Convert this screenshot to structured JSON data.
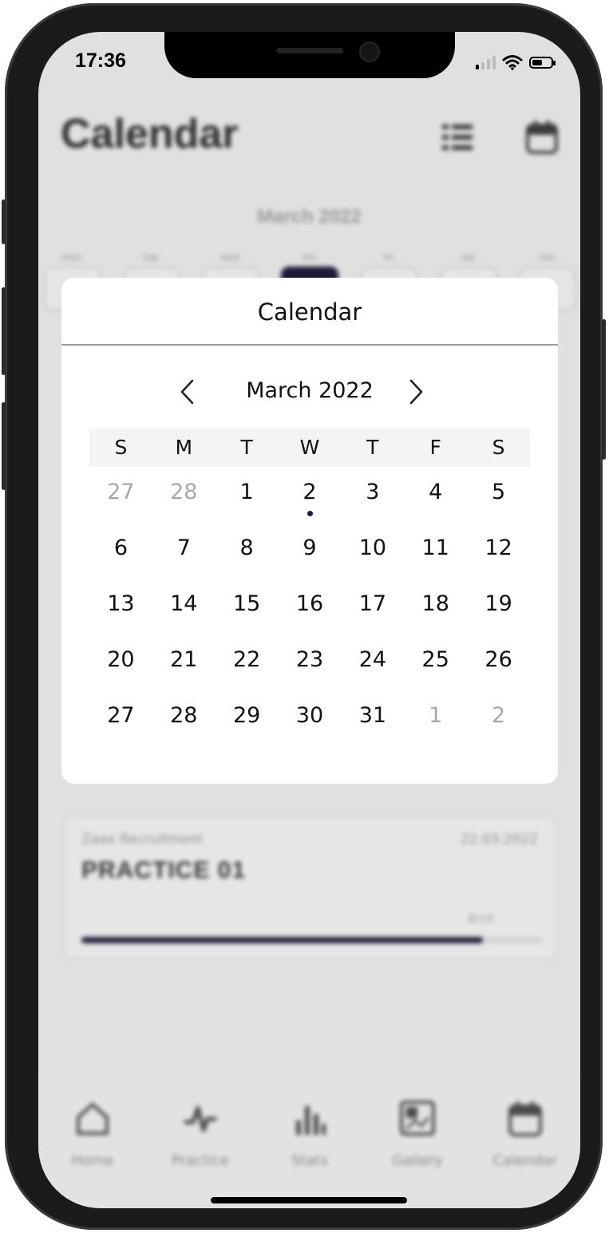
{
  "status_bar": {
    "time": "17:36"
  },
  "background": {
    "title": "Calendar",
    "month_label": "March 2022",
    "weekdays": [
      "mon",
      "tue",
      "wed",
      "thu",
      "fri",
      "sat",
      "sun"
    ],
    "card": {
      "subtitle": "Zaax Recruitment",
      "date": "22.03.2022",
      "name": "PRACTICE 01",
      "count": "8/10",
      "progress": 0.87
    },
    "tabs": [
      {
        "label": "Home",
        "icon": "home-icon"
      },
      {
        "label": "Practice",
        "icon": "pulse-icon"
      },
      {
        "label": "Stats",
        "icon": "bar-chart-icon"
      },
      {
        "label": "Gallery",
        "icon": "image-icon"
      },
      {
        "label": "Calendar",
        "icon": "calendar-icon"
      }
    ]
  },
  "modal": {
    "title": "Calendar",
    "month_label": "March 2022",
    "dow": [
      "S",
      "M",
      "T",
      "W",
      "T",
      "F",
      "S"
    ],
    "weeks": [
      [
        {
          "d": "27",
          "muted": true
        },
        {
          "d": "28",
          "muted": true
        },
        {
          "d": "1"
        },
        {
          "d": "2",
          "dot": true
        },
        {
          "d": "3"
        },
        {
          "d": "4"
        },
        {
          "d": "5"
        }
      ],
      [
        {
          "d": "6"
        },
        {
          "d": "7"
        },
        {
          "d": "8"
        },
        {
          "d": "9"
        },
        {
          "d": "10"
        },
        {
          "d": "11"
        },
        {
          "d": "12"
        }
      ],
      [
        {
          "d": "13"
        },
        {
          "d": "14"
        },
        {
          "d": "15"
        },
        {
          "d": "16"
        },
        {
          "d": "17"
        },
        {
          "d": "18"
        },
        {
          "d": "19"
        }
      ],
      [
        {
          "d": "20"
        },
        {
          "d": "21"
        },
        {
          "d": "22"
        },
        {
          "d": "23"
        },
        {
          "d": "24"
        },
        {
          "d": "25"
        },
        {
          "d": "26"
        }
      ],
      [
        {
          "d": "27"
        },
        {
          "d": "28"
        },
        {
          "d": "29"
        },
        {
          "d": "30"
        },
        {
          "d": "31"
        },
        {
          "d": "1",
          "muted": true
        },
        {
          "d": "2",
          "muted": true
        }
      ]
    ]
  },
  "colors": {
    "accent": "#1e1b3a",
    "muted_text": "#a8a8a8",
    "overlay_bg": "#e0e0e0"
  }
}
